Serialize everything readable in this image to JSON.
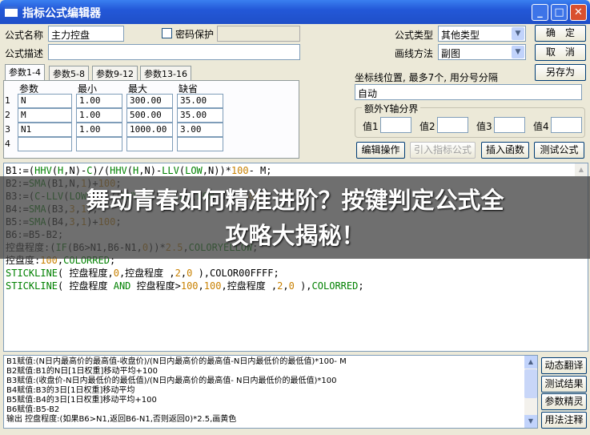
{
  "window": {
    "title": "指标公式编辑器",
    "min": "_",
    "max": "□",
    "close": "✕"
  },
  "form": {
    "name_label": "公式名称",
    "name_value": "主力控盘",
    "password_label": "密码保护",
    "password_checked": false,
    "desc_label": "公式描述",
    "desc_value": "",
    "type_label": "公式类型",
    "type_value": "其他类型",
    "draw_label": "画线方法",
    "draw_value": "副图",
    "coord_label": "坐标线位置, 最多7个, 用分号分隔",
    "coord_value": "自动",
    "yaxis_label": "额外Y轴分界",
    "values": [
      {
        "label": "值1",
        "value": ""
      },
      {
        "label": "值2",
        "value": ""
      },
      {
        "label": "值3",
        "value": ""
      },
      {
        "label": "值4",
        "value": ""
      }
    ]
  },
  "buttons": {
    "ok": "确　定",
    "cancel": "取　消",
    "save_as": "另存为",
    "edit_ops": "编辑操作",
    "import": "引入指标公式",
    "insert_fn": "插入函数",
    "test": "测试公式",
    "dyn_translate": "动态翻译",
    "test_result": "测试结果",
    "param_wizard": "参数精灵",
    "usage": "用法注释"
  },
  "tabs": [
    {
      "label": "参数1-4",
      "active": true
    },
    {
      "label": "参数5-8"
    },
    {
      "label": "参数9-12"
    },
    {
      "label": "参数13-16"
    }
  ],
  "params": {
    "headers": [
      "参数",
      "最小",
      "最大",
      "缺省"
    ],
    "rows": [
      [
        "1",
        "N",
        "1.00",
        "300.00",
        "35.00"
      ],
      [
        "2",
        "M",
        "1.00",
        "500.00",
        "35.00"
      ],
      [
        "3",
        "N1",
        "1.00",
        "1000.00",
        "3.00"
      ],
      [
        "4",
        "",
        "",
        "",
        ""
      ]
    ]
  },
  "code": [
    [
      [
        "B1:=(",
        ""
      ],
      [
        "HHV",
        "fn"
      ],
      [
        "(",
        ""
      ],
      [
        "H",
        "fn"
      ],
      [
        ",N)-",
        ""
      ],
      [
        "C",
        "fn"
      ],
      [
        ")/(",
        ""
      ],
      [
        "HHV",
        "fn"
      ],
      [
        "(",
        ""
      ],
      [
        "H",
        "fn"
      ],
      [
        ",N)-",
        ""
      ],
      [
        "LLV",
        "fn"
      ],
      [
        "(",
        ""
      ],
      [
        "LOW",
        "fn"
      ],
      [
        ",N))*",
        ""
      ],
      [
        "100",
        "num"
      ],
      [
        "- M;",
        ""
      ]
    ],
    [
      [
        "B2:=",
        ""
      ],
      [
        "SMA",
        "fn"
      ],
      [
        "(B1,N,",
        ""
      ],
      [
        "1",
        "num"
      ],
      [
        ")+",
        ""
      ],
      [
        "100",
        "num"
      ],
      [
        ";",
        ""
      ]
    ],
    [
      [
        "B3:=(",
        ""
      ],
      [
        "C",
        "fn"
      ],
      [
        "-",
        ""
      ],
      [
        "LLV",
        "fn"
      ],
      [
        "(",
        ""
      ],
      [
        "LOW",
        "fn"
      ],
      [
        ",N))/(",
        ""
      ],
      [
        "HHV",
        "fn"
      ],
      [
        "(",
        ""
      ],
      [
        "H",
        "fn"
      ],
      [
        ",N)-",
        ""
      ],
      [
        "LLV",
        "fn"
      ],
      [
        "(",
        ""
      ],
      [
        "LOW",
        "fn"
      ],
      [
        ",N))*",
        ""
      ],
      [
        "100",
        "num"
      ],
      [
        ";",
        ""
      ]
    ],
    [
      [
        "B4:=",
        ""
      ],
      [
        "SMA",
        "fn"
      ],
      [
        "(B3,",
        ""
      ],
      [
        "3",
        "num"
      ],
      [
        ",",
        ""
      ],
      [
        "1",
        "num"
      ],
      [
        ");",
        ""
      ]
    ],
    [
      [
        "B5:=",
        ""
      ],
      [
        "SMA",
        "fn"
      ],
      [
        "(B4,",
        ""
      ],
      [
        "3",
        "num"
      ],
      [
        ",",
        ""
      ],
      [
        "1",
        "num"
      ],
      [
        ")+",
        ""
      ],
      [
        "100",
        "num"
      ],
      [
        ";",
        ""
      ]
    ],
    [
      [
        "B6:=B5-B2;",
        ""
      ]
    ],
    [
      [
        "控盘程度:(",
        ""
      ],
      [
        "IF",
        "fn"
      ],
      [
        "(B6>N1,B6-N1,",
        ""
      ],
      [
        "0",
        "num"
      ],
      [
        "))*",
        ""
      ],
      [
        "2.5",
        "num"
      ],
      [
        ",",
        ""
      ],
      [
        "COLORYELLOW",
        "fn"
      ],
      [
        ";",
        ""
      ]
    ],
    [
      [
        "控盘度:",
        ""
      ],
      [
        "100",
        "num"
      ],
      [
        ",",
        ""
      ],
      [
        "COLORRED",
        "fn"
      ],
      [
        ";",
        ""
      ]
    ],
    [
      [
        "STICKLINE",
        "fn"
      ],
      [
        "( 控盘程度,",
        ""
      ],
      [
        "0",
        "num"
      ],
      [
        ",控盘程度 ,",
        ""
      ],
      [
        "2",
        "num"
      ],
      [
        ",",
        ""
      ],
      [
        "0",
        "num"
      ],
      [
        " ),COLOR00FFFF;",
        ""
      ]
    ],
    [
      [
        "STICKLINE",
        "fn"
      ],
      [
        "( 控盘程度 ",
        ""
      ],
      [
        "AND",
        "kw"
      ],
      [
        " 控盘程度>",
        ""
      ],
      [
        "100",
        "num"
      ],
      [
        ",",
        ""
      ],
      [
        "100",
        "num"
      ],
      [
        ",控盘程度 ,",
        ""
      ],
      [
        "2",
        "num"
      ],
      [
        ",",
        ""
      ],
      [
        "0",
        "num"
      ],
      [
        " ),",
        ""
      ],
      [
        "COLORRED",
        "fn"
      ],
      [
        ";",
        ""
      ]
    ]
  ],
  "banner": {
    "line1": "舞动青春如何精准进阶？按键判定公式全",
    "line2": "攻略大揭秘！"
  },
  "translation": [
    "B1赋值:(N日内最高价的最高值-收盘价)/(N日内最高价的最高值-N日内最低价的最低值)*100- M",
    "B2赋值:B1的N日[1日权重]移动平均+100",
    "B3赋值:(收盘价-N日内最低价的最低值)/(N日内最高价的最高值- N日内最低价的最低值)*100",
    "B4赋值:B3的3日[1日权重]移动平均",
    "B5赋值:B4的3日[1日权重]移动平均+100",
    "B6赋值:B5-B2",
    "输出 控盘程度:(如果B6>N1,返回B6-N1,否则返回0)*2.5,画黄色"
  ]
}
